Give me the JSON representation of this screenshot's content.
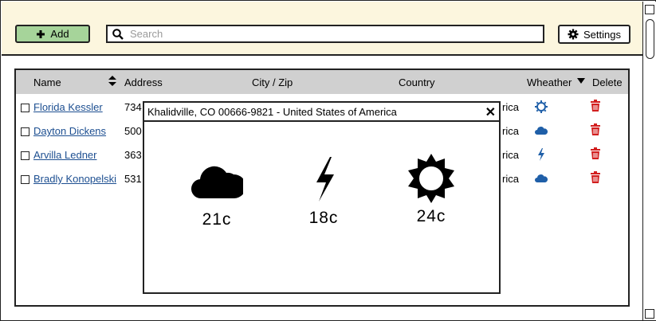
{
  "toolbar": {
    "add_label": "Add",
    "search_placeholder": "Search",
    "settings_label": "Settings"
  },
  "table": {
    "columns": [
      "Name",
      "Address",
      "City / Zip",
      "Country",
      "Wheather",
      "Delete"
    ],
    "rows": [
      {
        "name": "Florida Kessler",
        "address": "734",
        "country": "rica",
        "weather_icon": "sun-icon"
      },
      {
        "name": "Dayton Dickens",
        "address": "500",
        "country": "rica",
        "weather_icon": "cloud-icon"
      },
      {
        "name": "Arvilla Ledner",
        "address": "363",
        "country": "rica",
        "weather_icon": "lightning-icon"
      },
      {
        "name": "Bradly Konopelski",
        "address": "531",
        "country": "rica",
        "weather_icon": "cloud-icon"
      }
    ]
  },
  "popup": {
    "title": "Khalidville, CO 00666-9821 - United States of America",
    "forecast": [
      {
        "icon": "cloud-icon",
        "temp": "21c"
      },
      {
        "icon": "lightning-icon",
        "temp": "18c"
      },
      {
        "icon": "sun-icon",
        "temp": "24c"
      }
    ]
  },
  "colors": {
    "topbar_bg": "#fcf6de",
    "add_button": "#a6d49a",
    "link": "#1d4f91",
    "weather_icon": "#1f5fa8",
    "delete_icon": "#d21f1f",
    "header_bg": "#d0d0d0"
  }
}
